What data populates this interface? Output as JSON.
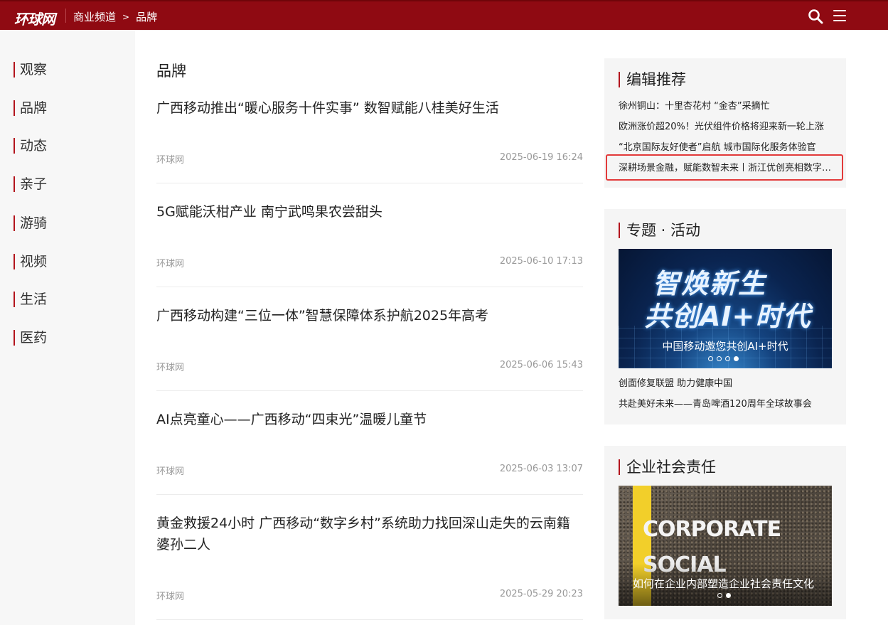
{
  "header": {
    "logo": "环球网",
    "breadcrumb": [
      "商业频道",
      "品牌"
    ],
    "breadcrumb_sep": ">",
    "icons": [
      "search-icon",
      "menu-icon"
    ]
  },
  "sidebar": {
    "items": [
      {
        "label": "观察"
      },
      {
        "label": "品牌"
      },
      {
        "label": "动态"
      },
      {
        "label": "亲子"
      },
      {
        "label": "游骑"
      },
      {
        "label": "视频"
      },
      {
        "label": "生活"
      },
      {
        "label": "医药"
      }
    ]
  },
  "main": {
    "title": "品牌",
    "articles": [
      {
        "title": "广西移动推出“暖心服务十件实事” 数智赋能八桂美好生活",
        "source": "环球网",
        "date": "2025-06-19 16:24"
      },
      {
        "title": "5G赋能沃柑产业 南宁武鸣果农尝甜头",
        "source": "环球网",
        "date": "2025-06-10 17:13"
      },
      {
        "title": "广西移动构建“三位一体”智慧保障体系护航2025年高考",
        "source": "环球网",
        "date": "2025-06-06 15:43"
      },
      {
        "title": "AI点亮童心——广西移动“四束光”温暖儿童节",
        "source": "环球网",
        "date": "2025-06-03 13:07"
      },
      {
        "title": "黄金救援24小时 广西移动“数字乡村”系统助力找回深山走失的云南籍婆孙二人",
        "source": "环球网",
        "date": "2025-05-29 20:23"
      }
    ]
  },
  "editor_picks": {
    "title": "编辑推荐",
    "items": [
      "徐州铜山：十里杏花村 “金杏”采摘忙",
      "欧洲涨价超20%！光伏组件价格将迎来新一轮上涨",
      "“北京国际友好使者”启航 城市国际化服务体验官",
      "深耕场景金融，赋能数智未来丨浙江优创亮相数字金融大会"
    ],
    "highlight_color": "#e23a3a"
  },
  "topics": {
    "title": "专题 · 活动",
    "banner": {
      "headline_1": "智焕新生",
      "headline_2": "共创AI+时代",
      "caption": "中国移动邀您共创AI+时代",
      "slides": 4,
      "active_slide": 4
    },
    "items": [
      "创面修复联盟 助力健康中国",
      "共赴美好未来——青岛啤酒120周年全球故事会"
    ]
  },
  "csr": {
    "title": "企业社会责任",
    "banner": {
      "word_1": "CORPORATE",
      "word_2": "SOCIAL",
      "caption": "如何在企业内部塑造企业社会责任文化",
      "slides": 2,
      "active_slide": 2
    }
  },
  "colors": {
    "header_bg": "#8f0a12",
    "accent": "#b2141c",
    "muted_text": "#999999"
  }
}
